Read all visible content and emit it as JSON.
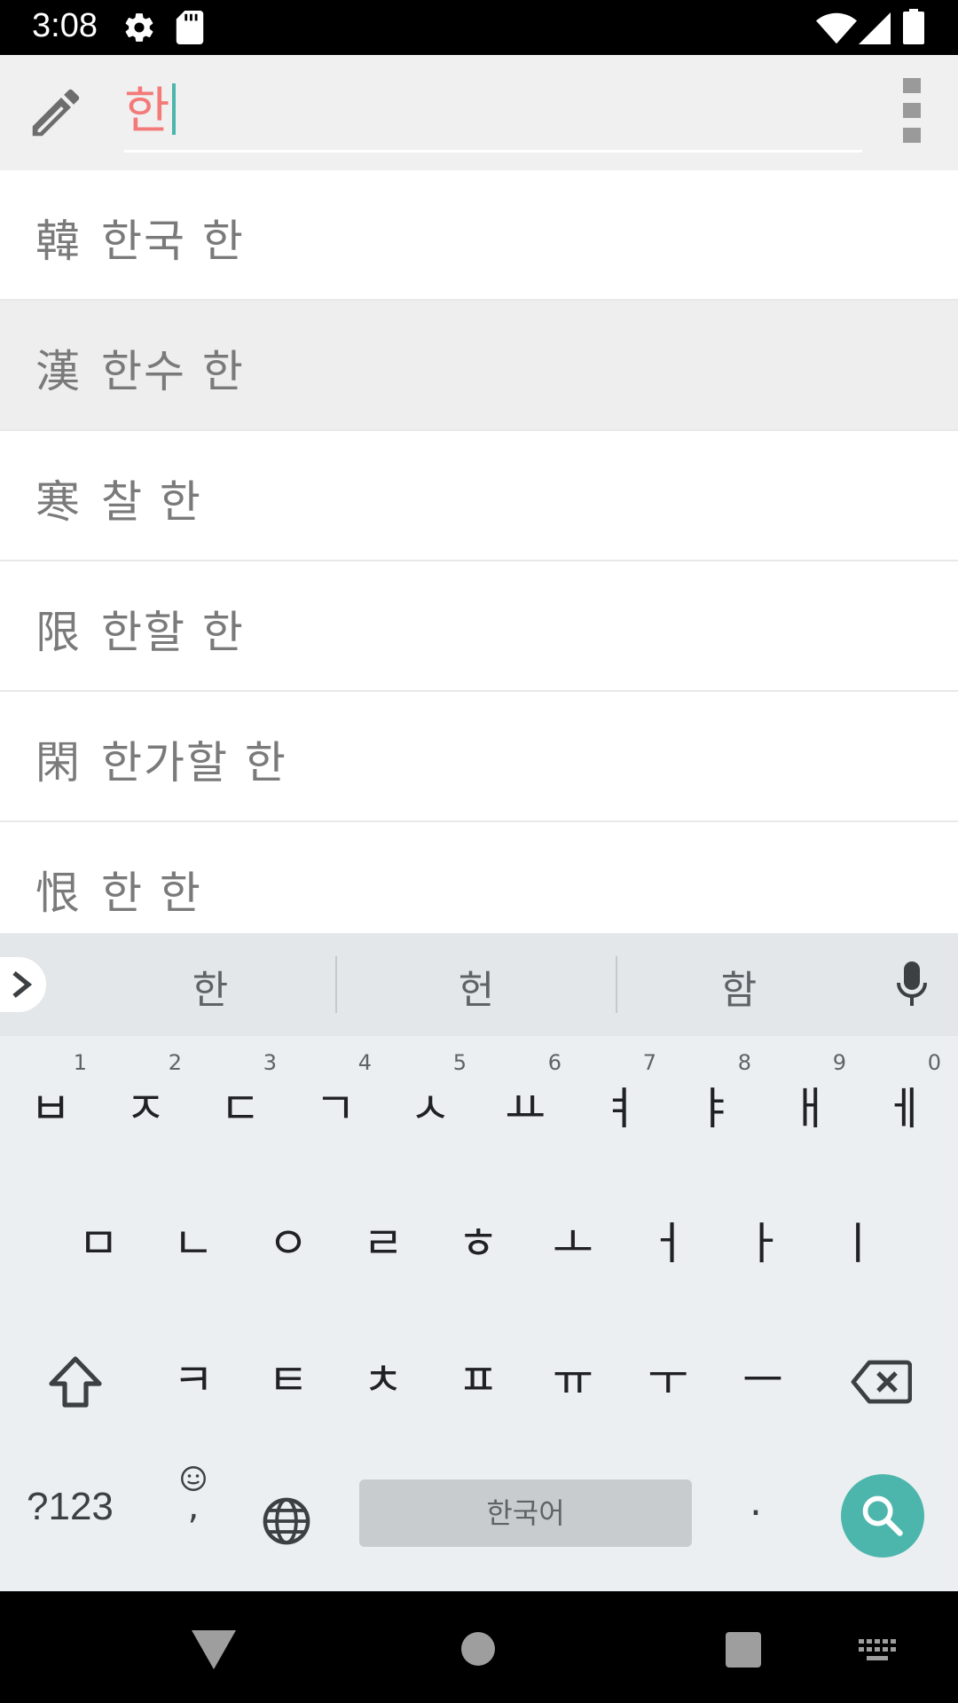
{
  "status_bar": {
    "time": "3:08",
    "icons": [
      "gear-icon",
      "sd-card-icon",
      "wifi-icon",
      "signal-icon",
      "battery-icon"
    ]
  },
  "search": {
    "query": "한",
    "accent_color": "#4db6ac",
    "query_color": "#f47a7a",
    "icons": [
      "pencil-icon",
      "overflow-menu-icon"
    ]
  },
  "results": [
    {
      "hanja": "韓",
      "meaning": "한국 한"
    },
    {
      "hanja": "漢",
      "meaning": "한수 한"
    },
    {
      "hanja": "寒",
      "meaning": "찰 한"
    },
    {
      "hanja": "限",
      "meaning": "한할 한"
    },
    {
      "hanja": "閑",
      "meaning": "한가할 한"
    },
    {
      "hanja": "恨",
      "meaning": "한 한"
    }
  ],
  "keyboard": {
    "suggestions": [
      "한",
      "헌",
      "함"
    ],
    "row1": [
      {
        "key": "ㅂ",
        "hint": "1"
      },
      {
        "key": "ㅈ",
        "hint": "2"
      },
      {
        "key": "ㄷ",
        "hint": "3"
      },
      {
        "key": "ㄱ",
        "hint": "4"
      },
      {
        "key": "ㅅ",
        "hint": "5"
      },
      {
        "key": "ㅛ",
        "hint": "6"
      },
      {
        "key": "ㅕ",
        "hint": "7"
      },
      {
        "key": "ㅑ",
        "hint": "8"
      },
      {
        "key": "ㅐ",
        "hint": "9"
      },
      {
        "key": "ㅔ",
        "hint": "0"
      }
    ],
    "row2": [
      "ㅁ",
      "ㄴ",
      "ㅇ",
      "ㄹ",
      "ㅎ",
      "ㅗ",
      "ㅓ",
      "ㅏ",
      "ㅣ"
    ],
    "row3": [
      "ㅋ",
      "ㅌ",
      "ㅊ",
      "ㅍ",
      "ㅠ",
      "ㅜ",
      "ㅡ"
    ],
    "symbols_label": "?123",
    "emoji_comma": ",",
    "space_label": "한국어",
    "period_label": "."
  },
  "nav_bar": {
    "icons": [
      "back-icon",
      "home-icon",
      "recents-icon",
      "keyboard-switch-icon"
    ]
  }
}
